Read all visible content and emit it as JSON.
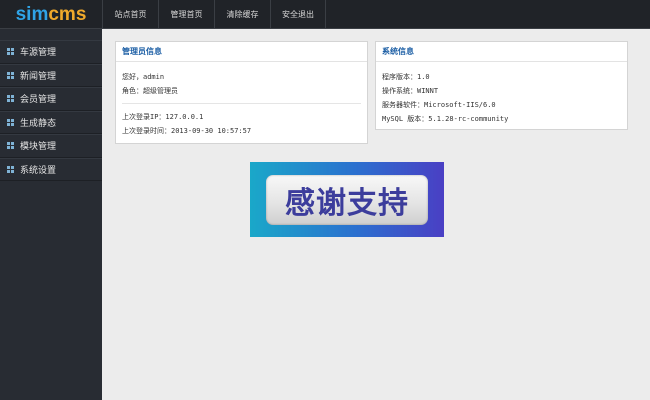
{
  "logo": {
    "part1": "sim",
    "part2": "cms"
  },
  "nav": [
    {
      "label": "站点首页"
    },
    {
      "label": "管理首页"
    },
    {
      "label": "清除缓存"
    },
    {
      "label": "安全退出"
    }
  ],
  "sidebar": {
    "items": [
      {
        "label": "车源管理"
      },
      {
        "label": "新闻管理"
      },
      {
        "label": "会员管理"
      },
      {
        "label": "生成静态"
      },
      {
        "label": "模块管理"
      },
      {
        "label": "系统设置"
      }
    ]
  },
  "admin_panel": {
    "title": "管理员信息",
    "greeting": "您好，admin",
    "role": "角色：超级管理员",
    "last_ip": "上次登录IP：127.0.0.1",
    "last_time": "上次登录时间：2013-09-30 10:57:57"
  },
  "sys_panel": {
    "title": "系统信息",
    "version": "程序版本：1.0",
    "os": "操作系统：WINNT",
    "server": "服务器软件：Microsoft-IIS/6.0",
    "mysql": "MySQL 版本：5.1.28-rc-community"
  },
  "banner": {
    "text": "感谢支持"
  },
  "colors": {
    "topbar": "#202328",
    "sidebar": "#282c33",
    "logo_blue": "#2fa3e6",
    "logo_orange": "#f0a92b",
    "panel_title": "#1d5fa5",
    "background": "#ececec"
  }
}
